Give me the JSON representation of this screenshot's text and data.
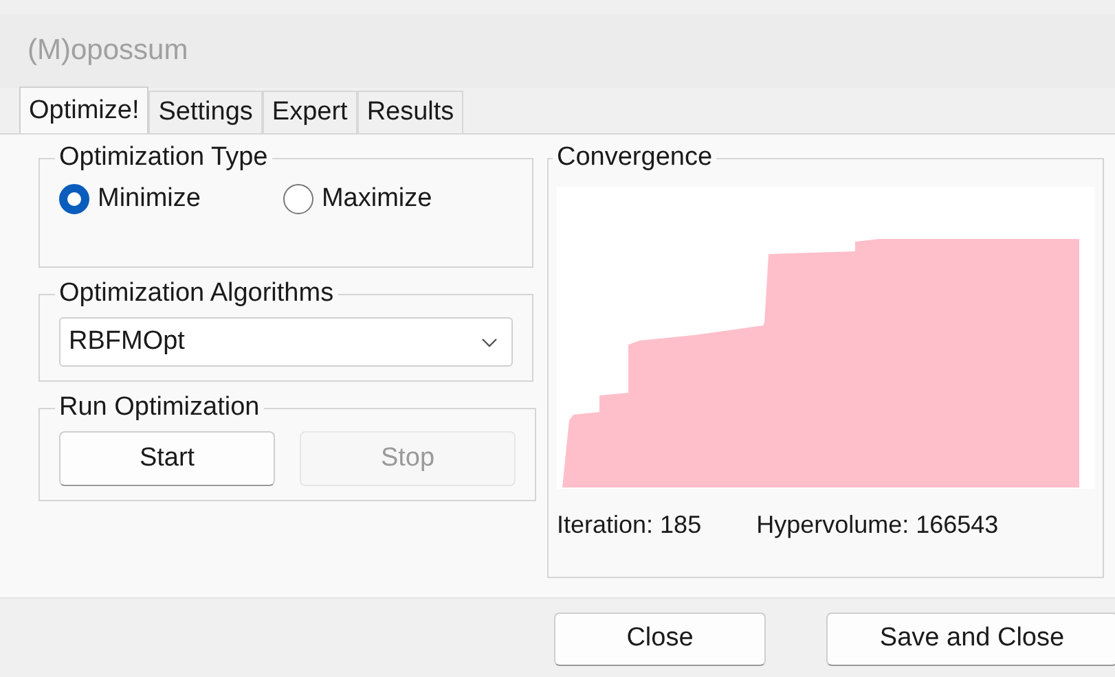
{
  "window": {
    "title": "(M)opossum"
  },
  "tabs": [
    {
      "label": "Optimize!",
      "selected": true
    },
    {
      "label": "Settings",
      "selected": false
    },
    {
      "label": "Expert",
      "selected": false
    },
    {
      "label": "Results",
      "selected": false
    }
  ],
  "optimization_type": {
    "title": "Optimization Type",
    "options": [
      {
        "label": "Minimize",
        "selected": true
      },
      {
        "label": "Maximize",
        "selected": false
      }
    ]
  },
  "algorithms": {
    "title": "Optimization Algorithms",
    "value": "RBFMOpt"
  },
  "run": {
    "title": "Run Optimization",
    "buttons": [
      {
        "label": "Start",
        "disabled": false
      },
      {
        "label": "Stop",
        "disabled": true
      }
    ]
  },
  "convergence": {
    "title": "Convergence",
    "iteration": "Iteration: 185",
    "hypervolume": "Hypervolume: 166543"
  },
  "buttons": [
    "Close",
    "Save and Close"
  ]
}
